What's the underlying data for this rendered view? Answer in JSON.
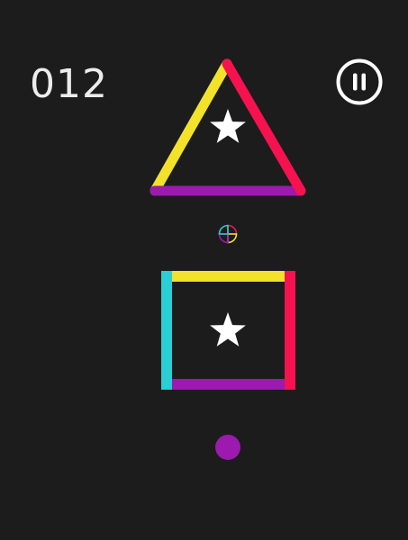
{
  "hud": {
    "score": "012"
  },
  "colors": {
    "background": "#1c1c1c",
    "yellow": "#f2e22a",
    "pink": "#f5124f",
    "purple": "#9c1aae",
    "cyan": "#29cfd4",
    "white": "#ffffff",
    "score_text": "#ececec"
  },
  "icons": {
    "pause": "pause-icon",
    "star": "star-icon",
    "color_switcher": "color-switcher-icon",
    "player": "player-ball"
  },
  "obstacles": {
    "triangle": {
      "segments": [
        "yellow",
        "pink",
        "purple"
      ]
    },
    "square": {
      "segments": [
        "yellow",
        "pink",
        "purple",
        "cyan"
      ]
    }
  },
  "player": {
    "color": "purple"
  }
}
